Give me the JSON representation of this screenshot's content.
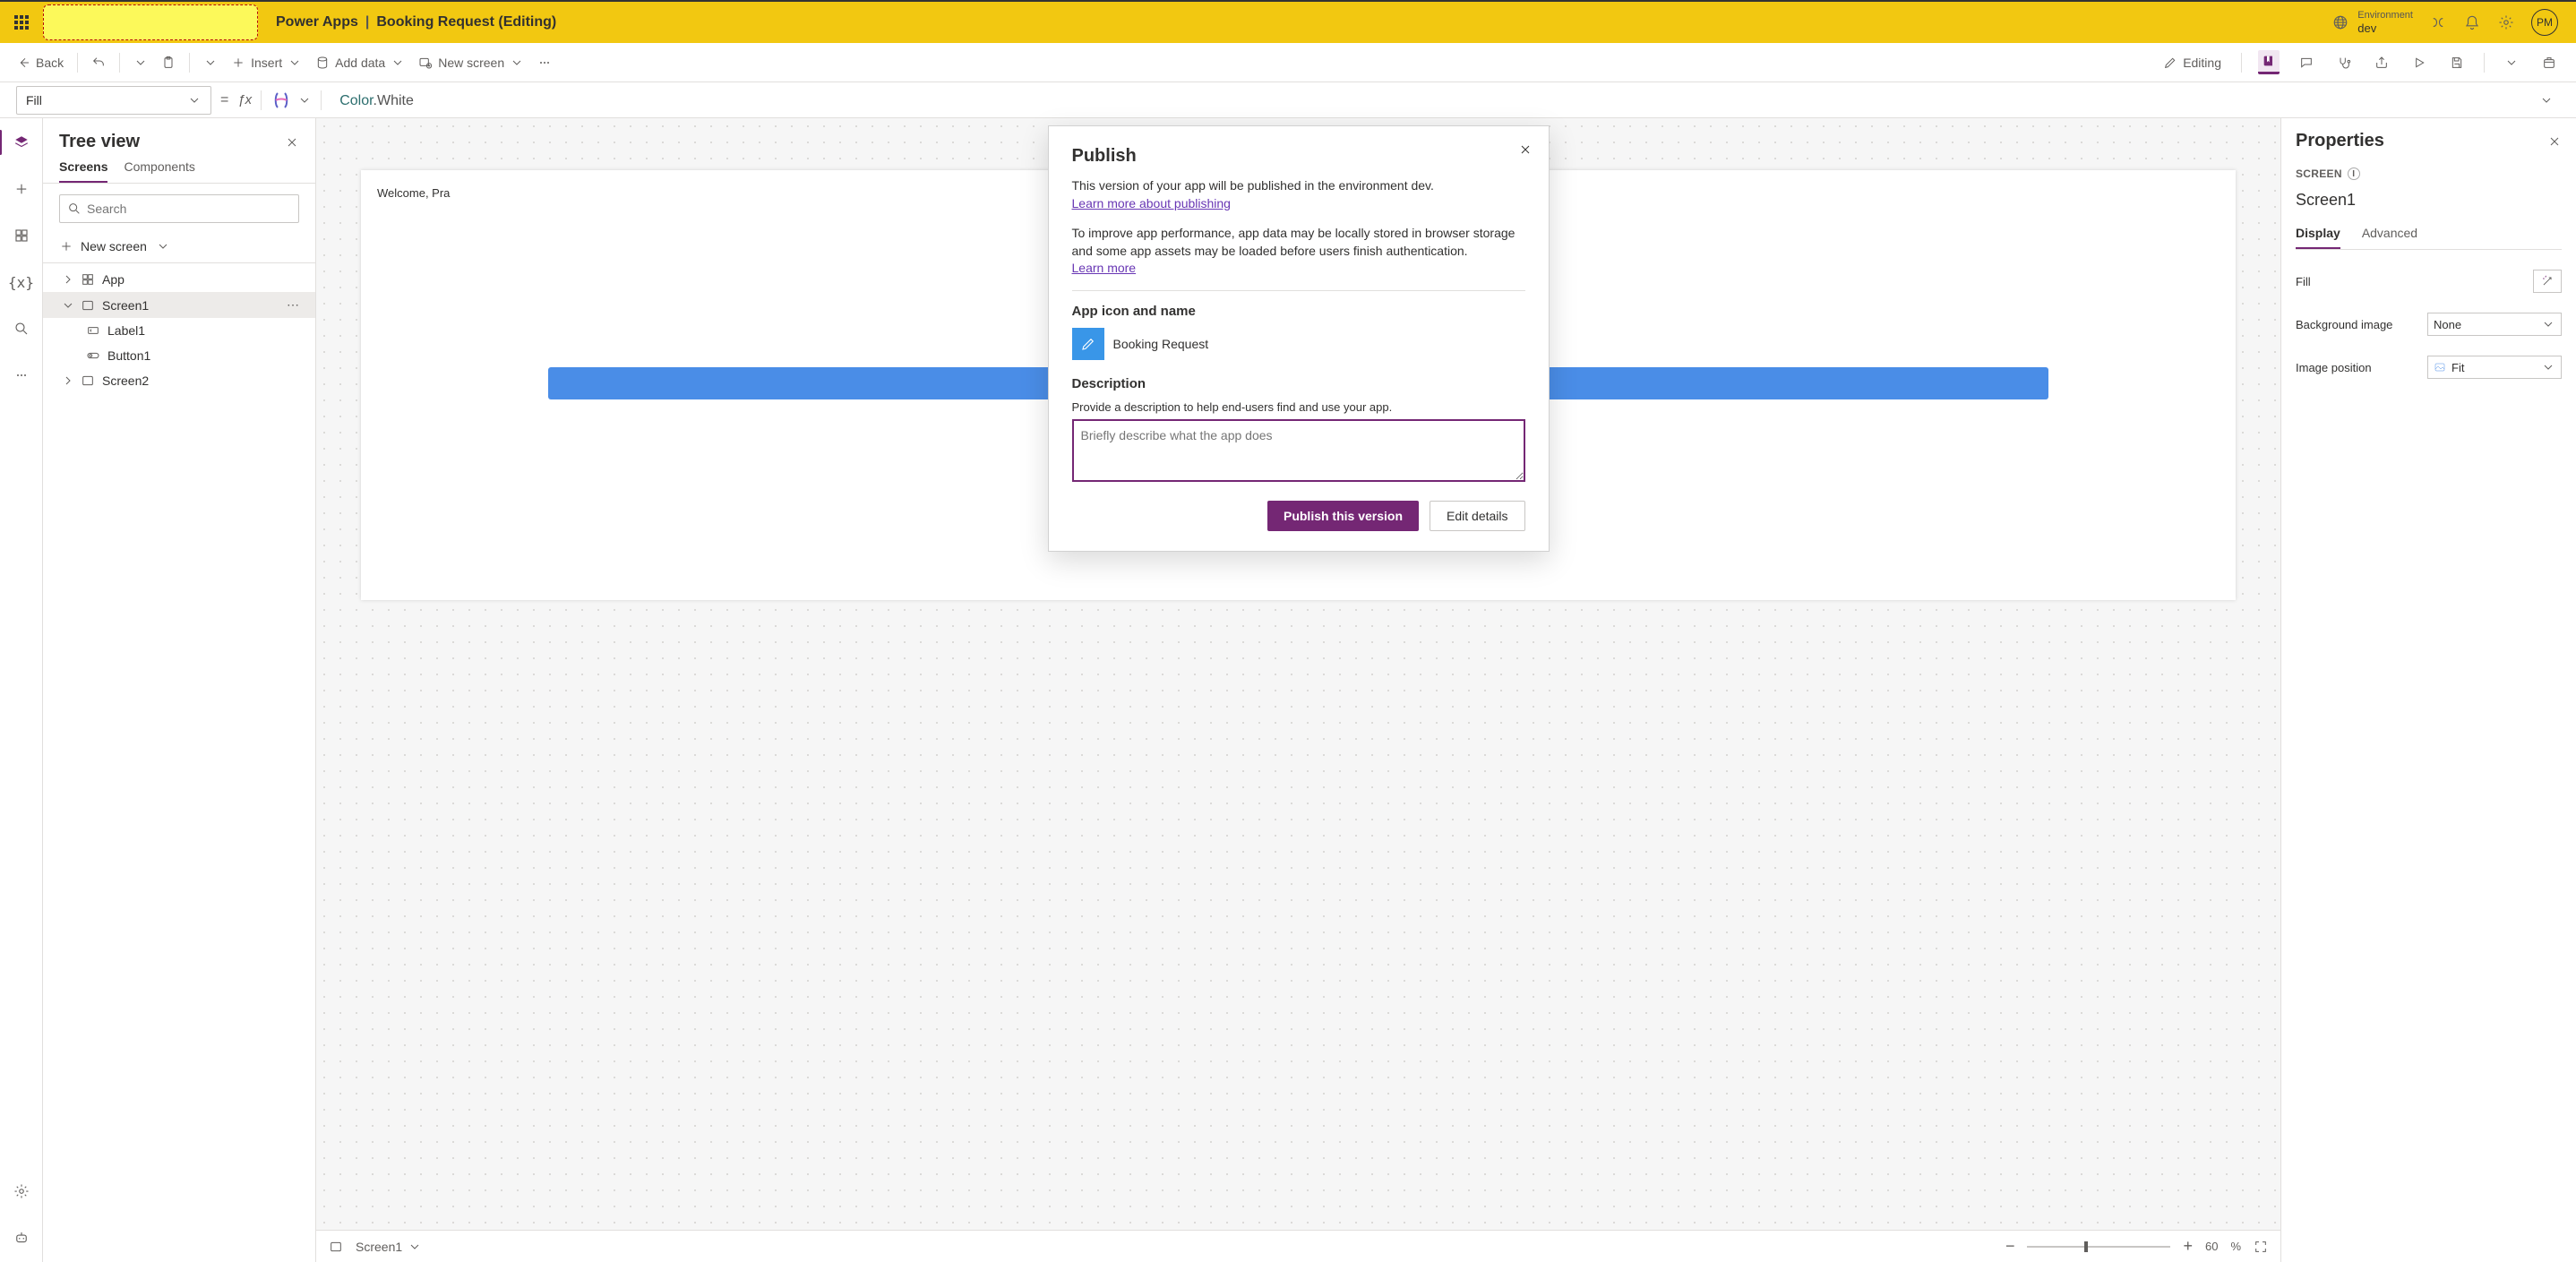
{
  "header": {
    "app_name": "Power Apps",
    "separator": "|",
    "page_title": "Booking Request (Editing)",
    "environment_label": "Environment",
    "environment_value": "dev",
    "avatar_initials": "PM"
  },
  "toolbar": {
    "back": "Back",
    "insert": "Insert",
    "add_data": "Add data",
    "new_screen": "New screen",
    "editing": "Editing"
  },
  "formula": {
    "property": "Fill",
    "equals": "=",
    "token_type": "Color",
    "token_prop": ".White"
  },
  "tree_view": {
    "title": "Tree view",
    "tabs": {
      "screens": "Screens",
      "components": "Components"
    },
    "search_placeholder": "Search",
    "new_screen": "New screen",
    "items": {
      "app": "App",
      "screen1": "Screen1",
      "label1": "Label1",
      "button1": "Button1",
      "screen2": "Screen2"
    }
  },
  "canvas": {
    "welcome_text": "Welcome, Pra"
  },
  "status_bar": {
    "screen_selector": "Screen1",
    "zoom_value": "60",
    "zoom_unit": "%"
  },
  "properties": {
    "title": "Properties",
    "section": "SCREEN",
    "element_name": "Screen1",
    "tabs": {
      "display": "Display",
      "advanced": "Advanced"
    },
    "rows": {
      "fill": "Fill",
      "bg_image": "Background image",
      "bg_image_val": "None",
      "img_pos": "Image position",
      "img_pos_val": "Fit"
    }
  },
  "modal": {
    "title": "Publish",
    "line1": "This version of your app will be published in the environment dev.",
    "link1": "Learn more about publishing",
    "line2": "To improve app performance, app data may be locally stored in browser storage and some app assets may be loaded before users finish authentication.",
    "link2": "Learn more",
    "section_icon": "App icon and name",
    "app_name": "Booking Request",
    "section_desc": "Description",
    "desc_hint": "Provide a description to help end-users find and use your app.",
    "desc_placeholder": "Briefly describe what the app does",
    "btn_publish": "Publish this version",
    "btn_edit": "Edit details"
  }
}
